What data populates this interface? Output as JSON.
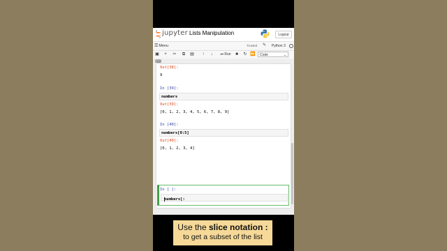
{
  "header": {
    "logo_text": "jupyter",
    "notebook_title": "Lists Manipulation",
    "logout_label": "Logout"
  },
  "menubar": {
    "menu_label": "Menu",
    "trusted_label": "Trusted",
    "kernel_name": "Python 3"
  },
  "toolbar": {
    "run_label": "Run",
    "cell_type": "Code"
  },
  "cells": {
    "c38": {
      "out_prompt": "Out[38]:",
      "output": "9"
    },
    "c39": {
      "in_prompt": "In [39]:",
      "code": "numbers",
      "out_prompt": "Out[39]:",
      "output": "[0, 1, 2, 3, 4, 5, 6, 7, 8, 9]"
    },
    "c40": {
      "in_prompt": "In [40]:",
      "code": "numbers[0:5]",
      "out_prompt": "Out[40]:",
      "output": "[0, 1, 2, 3, 4]"
    },
    "active": {
      "in_prompt": "In [ ]:",
      "code": "numbers[:"
    }
  },
  "caption": {
    "line1_prefix": "Use the ",
    "line1_emphasis": "slice notation :",
    "line2": "to get a subset of the list"
  },
  "colors": {
    "background": "#8c7d5f",
    "caption_bg": "#f6d998",
    "jupyter_orange": "#f37726",
    "out_prompt": "#d84315",
    "in_prompt": "#303f9f",
    "active_cell_border": "#42a047"
  },
  "icons": [
    "jupyter-logo-icon",
    "python-logo-icon",
    "menu-icon",
    "pencil-icon",
    "kernel-idle-icon",
    "save-icon",
    "add-cell-icon",
    "cut-icon",
    "copy-icon",
    "paste-icon",
    "move-up-icon",
    "move-down-icon",
    "run-icon",
    "stop-icon",
    "restart-icon",
    "restart-run-all-icon",
    "keyboard-icon"
  ]
}
